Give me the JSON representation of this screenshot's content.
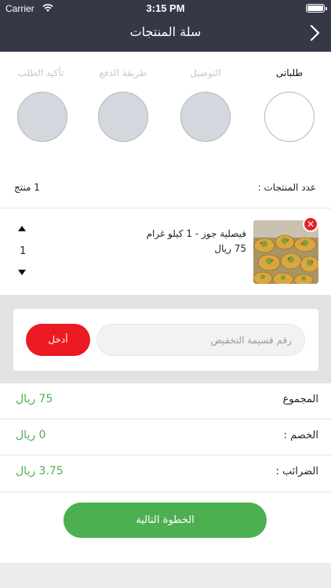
{
  "status_bar": {
    "carrier": "Carrier",
    "time": "3:15 PM"
  },
  "header": {
    "title": "سلة المنتجات"
  },
  "steps": [
    {
      "label": "طلباتى",
      "active": true
    },
    {
      "label": "التوصيل",
      "active": false
    },
    {
      "label": "طريقة الدفع",
      "active": false
    },
    {
      "label": "تأكيد الطلب",
      "active": false
    }
  ],
  "products_count": {
    "label": "عدد المنتجات :",
    "value": "1 منتج"
  },
  "cart_item": {
    "name": "فيصلية جوز - 1 كيلو غرام",
    "price": "75 ريال",
    "quantity": "1"
  },
  "coupon": {
    "placeholder": "رقم قسيمة التخفيض",
    "value": "",
    "apply_label": "أدخل"
  },
  "summary": [
    {
      "label": "المجموع",
      "value": "75 ريال"
    },
    {
      "label": "الخصم :",
      "value": "0 ريال"
    },
    {
      "label": "الضرائب :",
      "value": "3.75 ريال"
    }
  ],
  "next_button": {
    "label": "الخطوة التالية"
  },
  "colors": {
    "header_bg": "#363848",
    "accent_green": "#4caf50",
    "accent_red": "#ec1a22"
  },
  "icons": [
    "wifi-icon",
    "battery-icon",
    "chevron-right-icon",
    "close-icon",
    "triangle-up-icon",
    "triangle-down-icon"
  ]
}
